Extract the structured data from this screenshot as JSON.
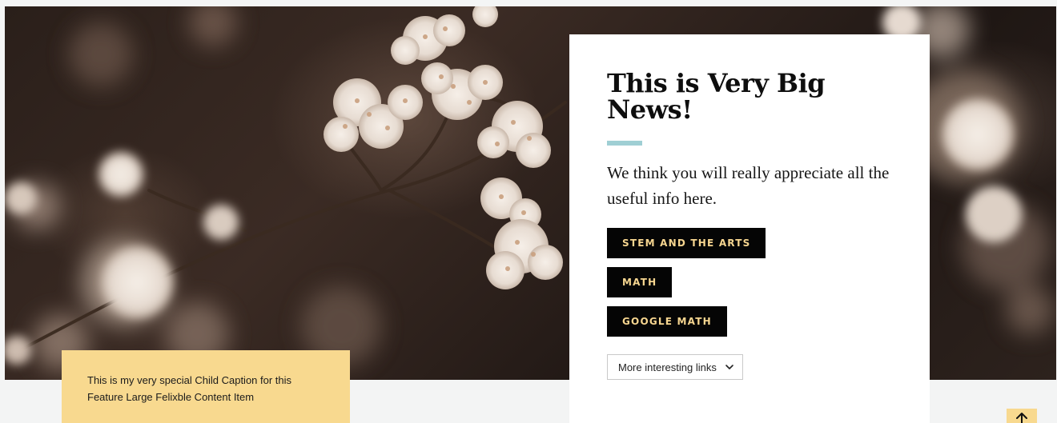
{
  "feature": {
    "title": "This is Very Big News!",
    "lede": "We think you will really appreciate all the useful info here.",
    "tags": [
      {
        "label": "STEM AND THE ARTS"
      },
      {
        "label": "MATH"
      },
      {
        "label": "GOOGLE MATH"
      }
    ],
    "more_links_label": "More interesting links",
    "accent_color": "#9fcfd4",
    "tag_text_color": "#f7d690"
  },
  "caption": {
    "text": "This is my very special Child Caption for this Feature Large Felixble Content Item",
    "background_color": "#f8d98f"
  },
  "hero_image": {
    "subject": "white-flower-clusters-on-dark-background"
  },
  "icons": {
    "more_links": "chevron-down-icon",
    "back_to_top": "arrow-up-icon"
  }
}
